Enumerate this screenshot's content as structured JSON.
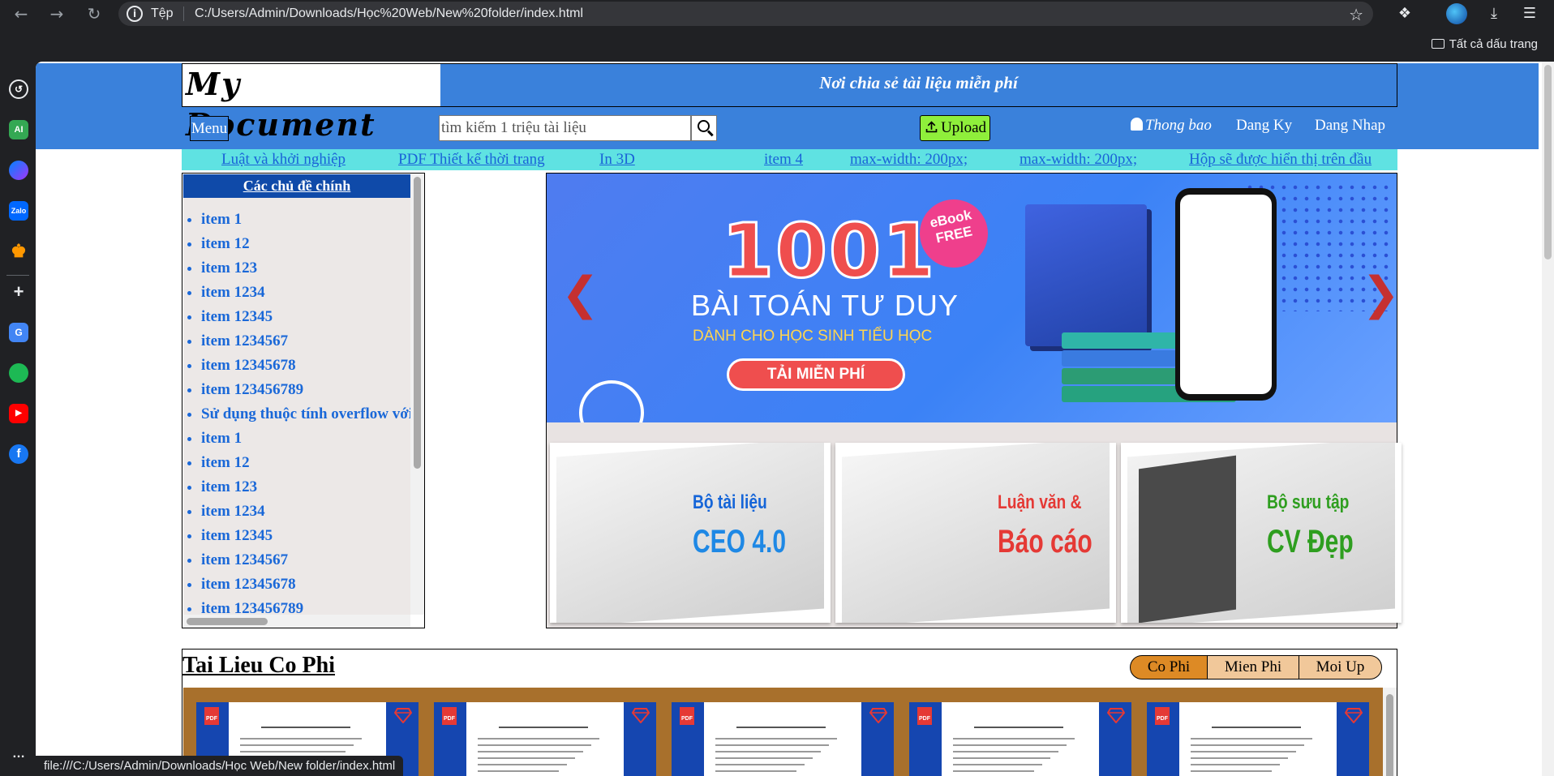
{
  "browser": {
    "scheme_label": "Tệp",
    "url": "C:/Users/Admin/Downloads/Học%20Web/New%20folder/index.html",
    "bookmarks_all_label": "Tất cả dấu trang",
    "status_url": "file:///C:/Users/Admin/Downloads/Học Web/New folder/index.html",
    "sidebar_apps": [
      "history-icon",
      "ai-icon",
      "messenger-icon",
      "zalo-icon",
      "crown-icon",
      "add-icon",
      "translate-icon",
      "spotify-icon",
      "youtube-icon",
      "facebook-icon"
    ],
    "sidebar_labels": {
      "ai": "AI",
      "zalo": "Zalo"
    }
  },
  "header": {
    "logo": "My Document",
    "slogan": "Nơi chia sẻ tài liệu miễn phí",
    "menu_label": "Menu",
    "search_placeholder": "tìm kiếm 1 triệu tài liệu",
    "upload_label": "Upload",
    "notification_label": "Thong bao",
    "register_label": "Dang Ky",
    "login_label": "Dang Nhap"
  },
  "subnav": [
    "Luật và khởi nghiệp",
    "PDF Thiết kế thời trang",
    "In 3D",
    "item 4",
    "max-width: 200px;",
    "max-width: 200px;",
    "Hộp sẽ được hiển thị trên đầu"
  ],
  "topics": {
    "title": "Các chủ đề chính",
    "items": [
      "item 1",
      "item 12",
      "item 123",
      "item 1234",
      "item 12345",
      "item 1234567",
      "item 12345678",
      "item 123456789",
      "Sử dụng thuộc tính overflow với",
      "item 1",
      "item 12",
      "item 123",
      "item 1234",
      "item 12345",
      "item 1234567",
      "item 12345678",
      "item 123456789"
    ]
  },
  "banner": {
    "hero_number": "1001",
    "hero_title": "BÀI TOÁN TƯ DUY",
    "hero_subtitle": "DÀNH CHO HỌC SINH TIỂU HỌC",
    "hero_button": "TẢI MIỄN PHÍ",
    "ebook_badge_line1": "eBook",
    "ebook_badge_line2": "FREE",
    "prev_icon": "chevron-left-icon",
    "next_icon": "chevron-right-icon",
    "cards": [
      {
        "line1": "Bộ tài liệu",
        "line2": "CEO 4.0",
        "color1": "#1565d8",
        "color2": "#1e88e5"
      },
      {
        "line1": "Luận văn &",
        "line2": "Báo cáo",
        "color1": "#e53935",
        "color2": "#e53935"
      },
      {
        "line1": "Bộ sưu tập",
        "line2": "CV Đẹp",
        "color1": "#2e9e1f",
        "color2": "#2e9e1f"
      }
    ]
  },
  "fee_section": {
    "title": "Tai Lieu Co Phi",
    "tabs": [
      "Co Phi",
      "Mien Phi",
      "Moi Up"
    ],
    "active_tab": "Co Phi",
    "pdf_label": "PDF",
    "doc_count": 5
  },
  "colors": {
    "header_blue": "#3a81db",
    "cyan_bar": "#5fe2e2",
    "topic_title_bg": "#0f4aa9",
    "upload_green": "#8fef3b",
    "tab_active": "#dd8a25",
    "tab_inactive": "#f1c89a",
    "gallery_brown": "#a8702c"
  }
}
